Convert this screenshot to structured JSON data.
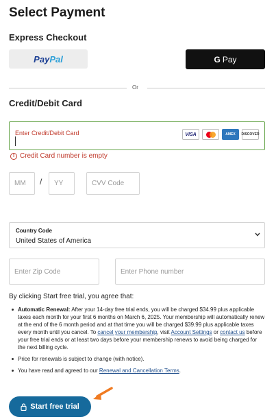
{
  "page": {
    "title": "Select Payment"
  },
  "express": {
    "heading": "Express Checkout",
    "paypal_pay": "Pay",
    "paypal_pal": "Pal",
    "gpay_g": "G",
    "gpay_label": "Pay",
    "or": "Or"
  },
  "card": {
    "heading": "Credit/Debit Card",
    "placeholder": "Enter Credit/Debit Card",
    "error": "Credit Card number is empty",
    "brands": [
      "VISA",
      "MC",
      "AMERICAN EXPRESS",
      "DISCOVER"
    ],
    "mm_placeholder": "MM",
    "yy_placeholder": "YY",
    "separator": "/",
    "cvv_placeholder": "CVV Code"
  },
  "country": {
    "label": "Country Code",
    "value": "United States of America"
  },
  "zip": {
    "placeholder": "Enter Zip Code"
  },
  "phone": {
    "placeholder": "Enter Phone number"
  },
  "terms": {
    "agree": "By clicking Start free trial, you agree that:",
    "renewal_bold": "Automatic Renewal:",
    "renewal_text": " After your 14-day free trial ends, you will be charged $34.99 plus applicable taxes each month for your first 6 months on March 6, 2025. Your membership will automatically renew at the end of the 6 month period and at that time you will be charged $39.99 plus applicable taxes every month until you cancel. To ",
    "cancel_link": "cancel your membership",
    "visit": ", visit ",
    "account_link": "Account Settings",
    "or_word": " or ",
    "contact_link": "contact us",
    "renewal_tail": " before your free trial ends or at least two days before your membership renews to avoid being charged for the next billing cycle.",
    "price_change": "Price for renewals is subject to change (with notice).",
    "read_agreed": "You have read and agreed to our ",
    "renewal_terms_link": "Renewal and Cancellation Terms",
    "period": "."
  },
  "cta": {
    "label": "Start free trial"
  },
  "colors": {
    "accent": "#166a9c",
    "error": "#c0392b",
    "arrow": "#f07b22",
    "valid_border": "#6aa84f"
  }
}
